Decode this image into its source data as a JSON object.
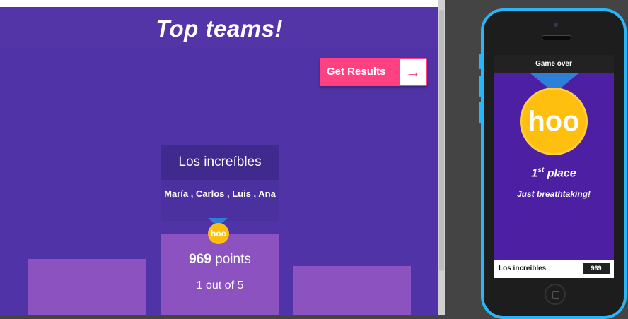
{
  "game": {
    "title": "Top teams!",
    "get_results_label": "Get Results",
    "arrow_glyph": "→",
    "team_name": "Los increíbles",
    "members": "María , Carlos , Luis , Ana",
    "medal_text": "hoo",
    "points_value": "969",
    "points_word": "points",
    "rank_text": "1 out of 5",
    "accent_color": "#ff4081",
    "background_color": "#5033a6"
  },
  "phone": {
    "header": "Game over",
    "medal_text": "hoo",
    "place_number": "1",
    "place_suffix": "st",
    "place_word": "place",
    "tagline": "Just breathtaking!",
    "team_name": "Los increíbles",
    "points": "969",
    "frame_color": "#29b6f6"
  }
}
